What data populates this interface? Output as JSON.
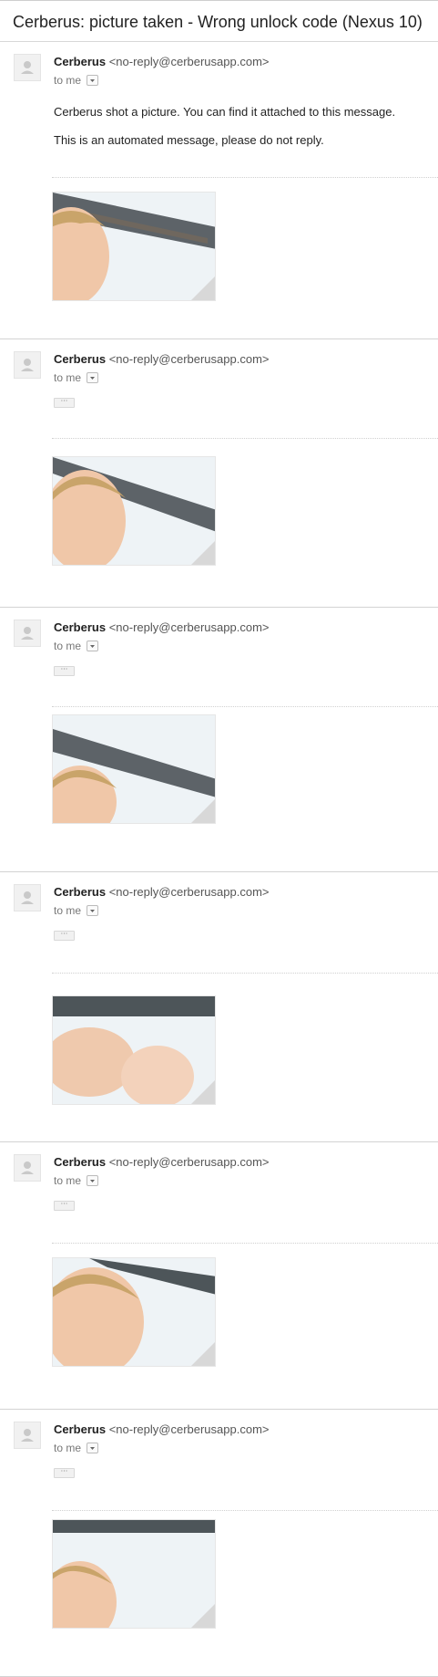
{
  "subject": "Cerberus: picture taken - Wrong unlock code (Nexus 10)",
  "messages": [
    {
      "sender_name": "Cerberus",
      "sender_email": "<no-reply@cerberusapp.com>",
      "to": "to me",
      "body": [
        "Cerberus shot a picture. You can find it attached to this message.",
        "This is an automated message, please do not reply."
      ],
      "ellipsis": ""
    },
    {
      "sender_name": "Cerberus",
      "sender_email": "<no-reply@cerberusapp.com>",
      "to": "to me",
      "ellipsis": "···"
    },
    {
      "sender_name": "Cerberus",
      "sender_email": "<no-reply@cerberusapp.com>",
      "to": "to me",
      "ellipsis": "···"
    },
    {
      "sender_name": "Cerberus",
      "sender_email": "<no-reply@cerberusapp.com>",
      "to": "to me",
      "ellipsis": "···"
    },
    {
      "sender_name": "Cerberus",
      "sender_email": "<no-reply@cerberusapp.com>",
      "to": "to me",
      "ellipsis": "···"
    },
    {
      "sender_name": "Cerberus",
      "sender_email": "<no-reply@cerberusapp.com>",
      "to": "to me",
      "ellipsis": "···"
    }
  ],
  "icons": {
    "avatar": "person-icon",
    "menu": "chevron-down-icon"
  },
  "colors": {
    "border": "#d3d3d3",
    "text": "#222222",
    "muted": "#777777"
  }
}
